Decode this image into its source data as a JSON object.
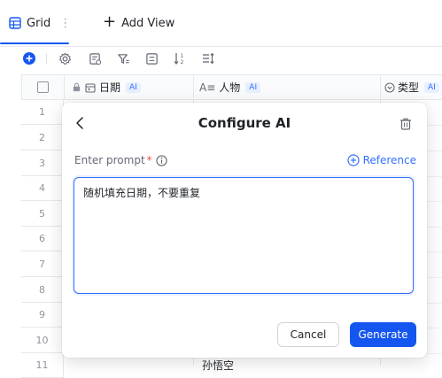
{
  "tabs": {
    "grid_label": "Grid",
    "add_view_label": "Add View"
  },
  "columns": [
    {
      "label": "日期",
      "ai": "AI"
    },
    {
      "label": "人物",
      "ai": "AI"
    },
    {
      "label": "类型",
      "ai": "AI"
    }
  ],
  "rows": [
    "1",
    "2",
    "3",
    "4",
    "5",
    "6",
    "7",
    "8",
    "9",
    "10",
    "11"
  ],
  "peek_text": "孙悟空",
  "dialog": {
    "title": "Configure AI",
    "prompt_label": "Enter prompt",
    "required_mark": "*",
    "reference_label": "Reference",
    "prompt_value": "随机填充日期，不要重复",
    "cancel_label": "Cancel",
    "generate_label": "Generate"
  },
  "colors": {
    "accent": "#1456f0",
    "link": "#3370ff",
    "required": "#f54a45"
  }
}
